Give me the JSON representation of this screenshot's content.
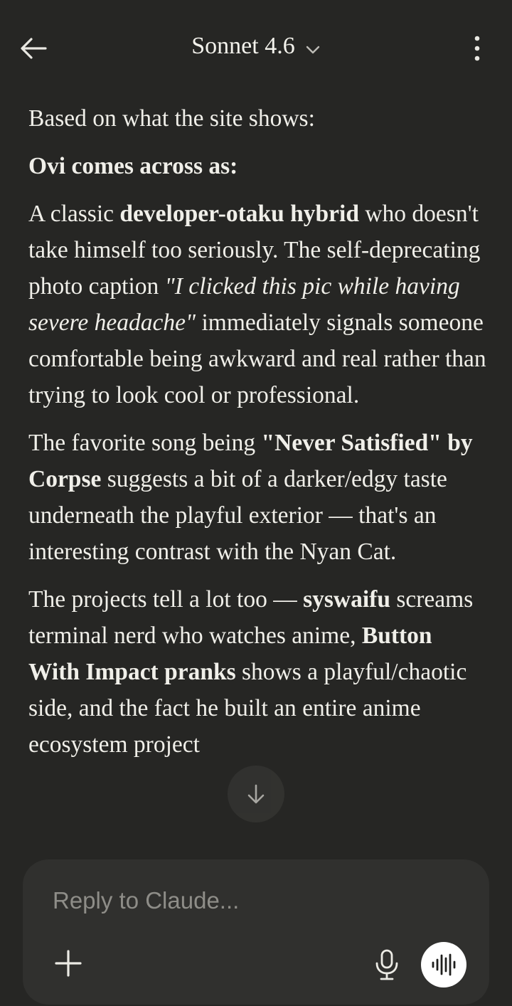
{
  "header": {
    "title": "Sonnet 4.6",
    "back_icon": "arrow-left-icon",
    "model_menu_icon": "chevron-down-icon",
    "more_icon": "more-vertical-icon"
  },
  "message": {
    "intro": "Based on what the site shows:",
    "heading": "Ovi comes across as:",
    "p1": {
      "t1": "A classic ",
      "b1": "developer-otaku hybrid",
      "t2": " who doesn't take himself too seriously. The self-deprecating photo caption ",
      "i1": "\"I clicked this pic while having severe headache\"",
      "t3": " immediately signals someone comfortable being awkward and real rather than trying to look cool or professional."
    },
    "p2": {
      "t1": "The favorite song being ",
      "b1": "\"Never Satisfied\" by Corpse",
      "t2": " suggests a bit of a darker/edgy taste underneath the playful exterior — that's an interesting contrast with the Nyan Cat."
    },
    "p3": {
      "t1": "The projects tell a lot too — ",
      "b1": "syswaifu",
      "t2": " screams terminal nerd who watches anime, ",
      "b2": "Button With Impact pranks",
      "t3": " shows a playful/chaotic side, and the fact he built an entire anime ecosystem project"
    }
  },
  "scroll_down_icon": "arrow-down-icon",
  "composer": {
    "placeholder": "Reply to Claude...",
    "add_icon": "plus-icon",
    "mic_icon": "microphone-icon",
    "voice_icon": "voice-waveform-icon"
  },
  "colors": {
    "background": "#262624",
    "composer_bg": "#30302e",
    "text": "#f0efe9",
    "placeholder": "#8e8d88"
  }
}
